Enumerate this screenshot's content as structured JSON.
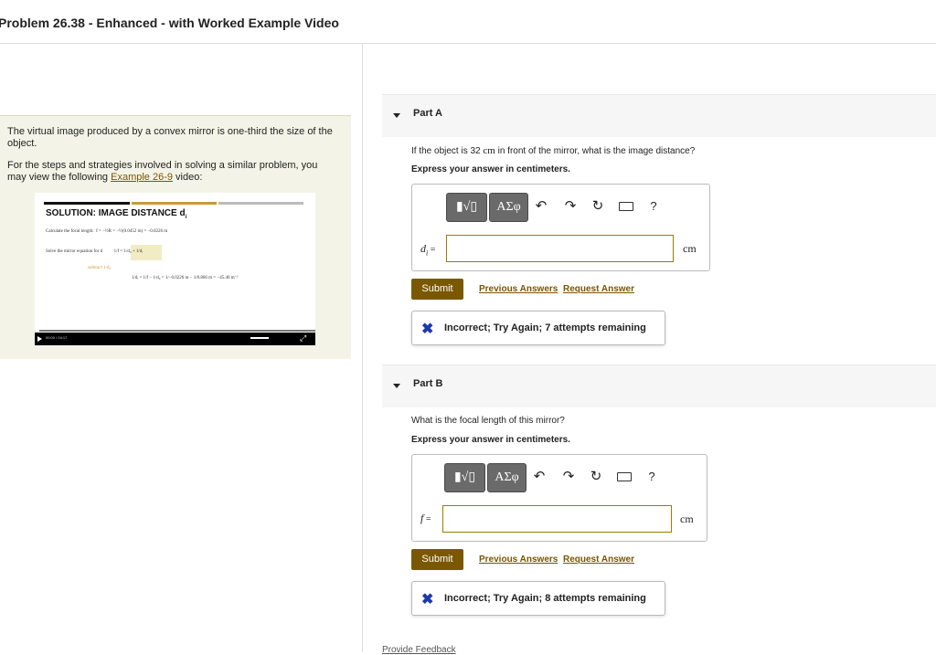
{
  "header": {
    "title": "Problem 26.38 - Enhanced - with Worked Example Video"
  },
  "problem": {
    "text_1": "The virtual image produced by a convex mirror is one-third the size of the object.",
    "text_2_prefix": "For the steps and strategies involved in solving a similar problem, you may view the following ",
    "text_2_link": "Example 26-9",
    "text_2_suffix": " video:"
  },
  "video": {
    "title": "SOLUTION: IMAGE DISTANCE d",
    "title_sub": "i",
    "line_1_label": "Calculate the focal length:",
    "line_1_eq": "f = −½R = −½(0.0452 m) = −0.0226 m",
    "line_2_label": "Solve the mirror equation for d",
    "line_2_eq": "1/f = 1/d₀ + 1/dᵢ",
    "line_3_label": "subtract 1/d₀",
    "line_4_eq": "1/dᵢ = 1/f − 1/d₀ = 1/−0.0226 m − 1/0.866 m = −45.40 m⁻¹",
    "time": "00:00 / 04:17"
  },
  "parts": [
    {
      "label": "Part A",
      "question_prefix": "If the object is 32 ",
      "question_unit": "cm",
      "question_suffix": " in front of the mirror, what is the image distance?",
      "instructions": "Express your answer in centimeters.",
      "variable": "d",
      "variable_sub": "i",
      "equals": " =",
      "input_value": "",
      "unit": "cm",
      "toolbar": {
        "templates": "▮√▯",
        "greek": "ΑΣφ",
        "undo": "↶",
        "redo": "↷",
        "reset": "↻",
        "help": "?"
      },
      "submit_label": "Submit",
      "previous_answers": "Previous Answers",
      "request_answer": "Request Answer",
      "feedback_icon": "✖",
      "feedback": "Incorrect; Try Again; 7 attempts remaining"
    },
    {
      "label": "Part B",
      "question_prefix": "What is the focal length of this mirror?",
      "question_unit": "",
      "question_suffix": "",
      "instructions": "Express your answer in centimeters.",
      "variable": "f",
      "variable_sub": "",
      "equals": " =",
      "input_value": "",
      "unit": "cm",
      "toolbar": {
        "templates": "▮√▯",
        "greek": "ΑΣφ",
        "undo": "↶",
        "redo": "↷",
        "reset": "↻",
        "help": "?"
      },
      "submit_label": "Submit",
      "previous_answers": "Previous Answers",
      "request_answer": "Request Answer",
      "feedback_icon": "✖",
      "feedback": "Incorrect; Try Again; 8 attempts remaining"
    }
  ],
  "footer": {
    "provide_feedback": "Provide Feedback"
  },
  "colors": {
    "accent": "#7a5800",
    "link": "#7a5500",
    "incorrect_icon": "#1e3aa8",
    "panel_bg": "#f3f4e7"
  }
}
